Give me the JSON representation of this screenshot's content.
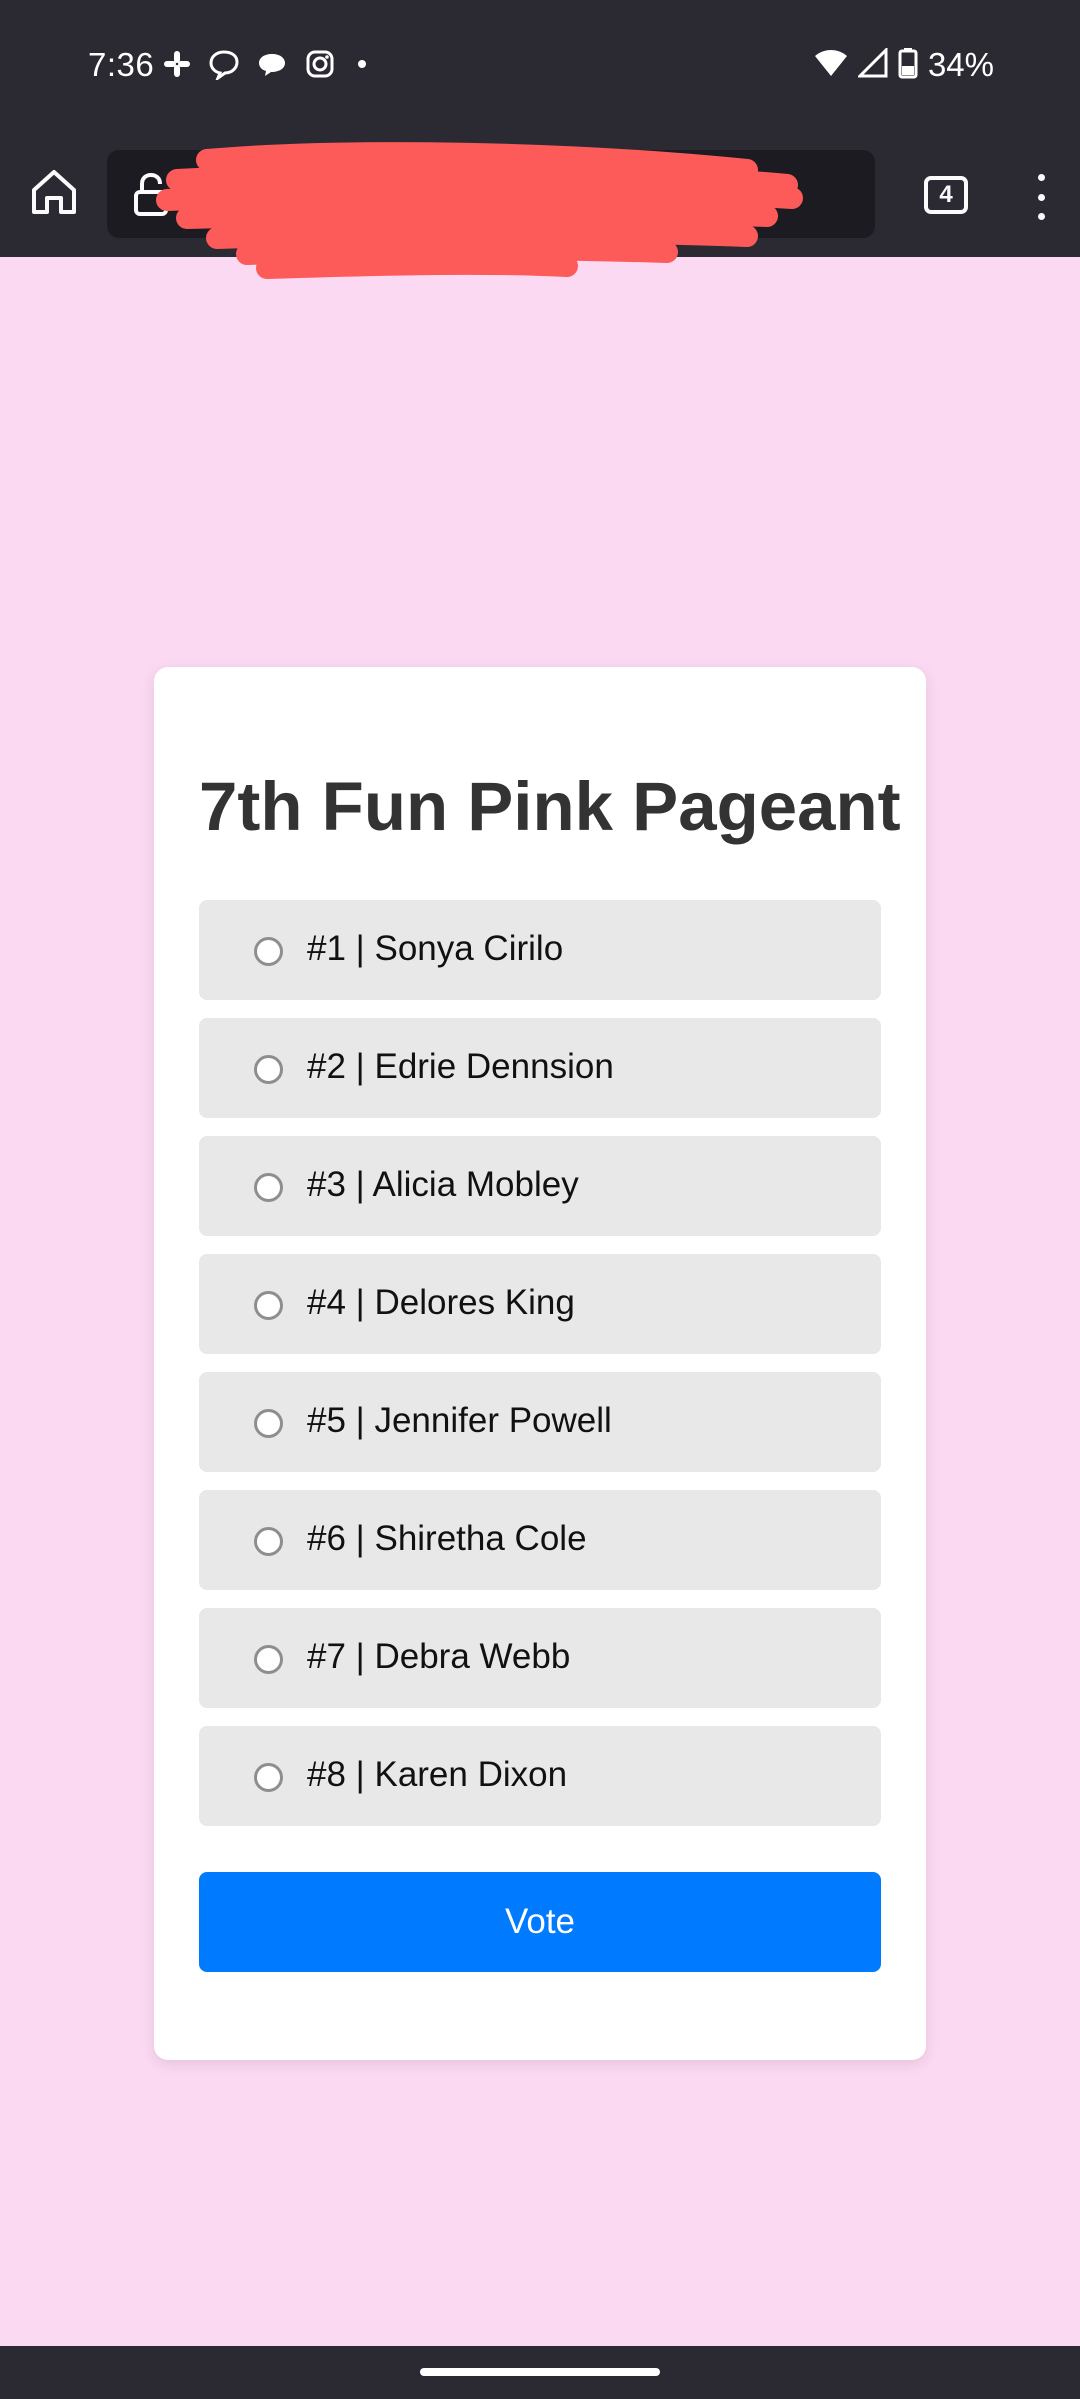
{
  "status_bar": {
    "time": "7:36",
    "battery": "34%",
    "notification_icons": [
      "slack-icon",
      "chat-bubble-icon",
      "messages-icon",
      "instagram-icon",
      "more-dot-icon"
    ],
    "system_icons": [
      "wifi-icon",
      "signal-icon",
      "battery-icon"
    ]
  },
  "browser": {
    "url": "···",
    "tab_count": "4"
  },
  "poll": {
    "title": "7th Fun Pink Pageant",
    "options": [
      {
        "label": "#1 | Sonya Cirilo"
      },
      {
        "label": "#2 | Edrie Dennsion"
      },
      {
        "label": "#3 | Alicia Mobley"
      },
      {
        "label": "#4 | Delores King"
      },
      {
        "label": "#5 | Jennifer Powell"
      },
      {
        "label": "#6 | Shiretha Cole"
      },
      {
        "label": "#7 | Debra Webb"
      },
      {
        "label": "#8 | Karen Dixon"
      }
    ],
    "vote_label": "Vote"
  },
  "colors": {
    "page_background": "#fcd9f2",
    "card_background": "#ffffff",
    "option_background": "#e8e8e8",
    "vote_button": "#007bff",
    "chrome": "#2b2a33",
    "redaction": "#fd5a5a"
  }
}
